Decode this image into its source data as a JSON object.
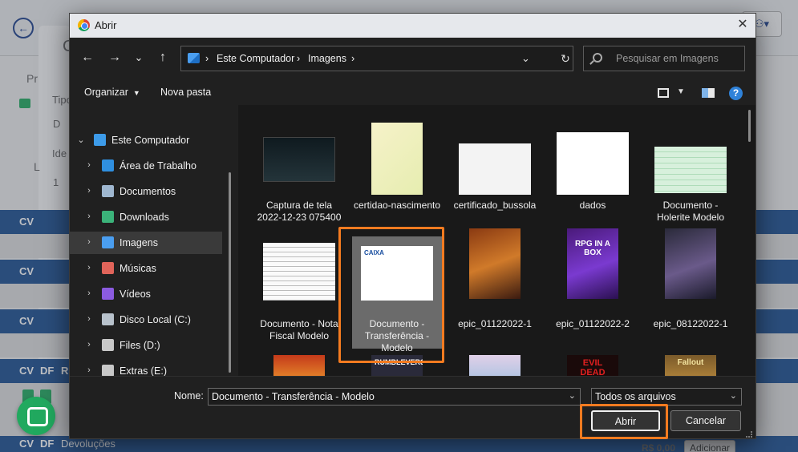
{
  "background": {
    "frag_pr": "Pr",
    "frag_tipo": "Tipo",
    "frag_d": "D",
    "frag_ide": "Ide",
    "frag_l": "L",
    "frag_1": "1",
    "frag_c": "C",
    "rows": [
      {
        "left": "CV",
        "mid": ""
      },
      {
        "left": "CV",
        "mid": ""
      },
      {
        "left": "CV",
        "mid": ""
      },
      {
        "left": "CV",
        "mid": "DF"
      }
    ],
    "row_extra": "R",
    "bottom_row": {
      "cv": "CV",
      "df": "DF",
      "label": "Devoluções",
      "price": "R$ 0,00",
      "button": "Adicionar"
    }
  },
  "dialog": {
    "title": "Abrir",
    "close_glyph": "✕",
    "nav": {
      "back": "←",
      "forward": "→",
      "recent": "⌄",
      "up": "↑",
      "refresh": "↻",
      "chevron": "›",
      "drop": "⌄"
    },
    "path": [
      "Este Computador",
      "Imagens"
    ],
    "search_placeholder": "Pesquisar em Imagens",
    "toolbar": {
      "organize": "Organizar",
      "new_folder": "Nova pasta",
      "help": "?"
    },
    "sidebar": [
      {
        "label": "Este Computador",
        "level": 0,
        "icon": "computer-icon",
        "color": "#3d9be9",
        "expanded": true
      },
      {
        "label": "Área de Trabalho",
        "level": 1,
        "icon": "desktop-icon",
        "color": "#2f8fe0"
      },
      {
        "label": "Documentos",
        "level": 1,
        "icon": "documents-icon",
        "color": "#9fb7d0"
      },
      {
        "label": "Downloads",
        "level": 1,
        "icon": "download-icon",
        "color": "#3bb37a"
      },
      {
        "label": "Imagens",
        "level": 1,
        "icon": "pictures-icon",
        "color": "#4a9ef0",
        "selected": true
      },
      {
        "label": "Músicas",
        "level": 1,
        "icon": "music-icon",
        "color": "#e0645a"
      },
      {
        "label": "Vídeos",
        "level": 1,
        "icon": "videos-icon",
        "color": "#8b5be0"
      },
      {
        "label": "Disco Local (C:)",
        "level": 1,
        "icon": "drive-c-icon",
        "color": "#b8c2cc"
      },
      {
        "label": "Files (D:)",
        "level": 1,
        "icon": "drive-d-icon",
        "color": "#c8c8c8"
      },
      {
        "label": "Extras (E:)",
        "level": 1,
        "icon": "drive-e-icon",
        "color": "#c8c8c8"
      }
    ],
    "files": [
      {
        "name": "Captura de tela 2022-12-23 075400",
        "thumb": "screenshot"
      },
      {
        "name": "certidao-nascimento",
        "thumb": "certificate"
      },
      {
        "name": "certificado_bussola",
        "thumb": "white-cert"
      },
      {
        "name": "dados",
        "thumb": "infographic"
      },
      {
        "name": "Documento - Holerite Modelo",
        "thumb": "spreadsheet"
      },
      {
        "name": "Documento - Nota Fiscal Modelo",
        "thumb": "invoice"
      },
      {
        "name": "Documento - Transferência - Modelo",
        "thumb": "caixa-doc",
        "selected": true
      },
      {
        "name": "epic_01122022-1",
        "thumb": "game-art-orange"
      },
      {
        "name": "epic_01122022-2",
        "thumb": "game-art-purple"
      },
      {
        "name": "epic_08122022-1",
        "thumb": "game-art-dark"
      },
      {
        "name": "",
        "thumb": "game-art-red"
      },
      {
        "name": "",
        "thumb": "game-art-rumbleverse"
      },
      {
        "name": "",
        "thumb": "game-art-anime"
      },
      {
        "name": "",
        "thumb": "game-art-evildead"
      },
      {
        "name": "",
        "thumb": "game-art-fallout"
      }
    ],
    "thumb_texts": {
      "caixa": "CAIXA",
      "rpg": "RPG IN A BOX",
      "rumbleverse": "RUMBLEVERSE",
      "evildead": "EVIL DEAD",
      "fallout": "Fallout"
    },
    "footer": {
      "name_label": "Nome:",
      "name_value": "Documento - Transferência - Modelo",
      "type_value": "Todos os arquivos",
      "open": "Abrir",
      "cancel": "Cancelar"
    },
    "colors": {
      "highlight": "#f47b20",
      "accent": "#2f82d9"
    }
  }
}
